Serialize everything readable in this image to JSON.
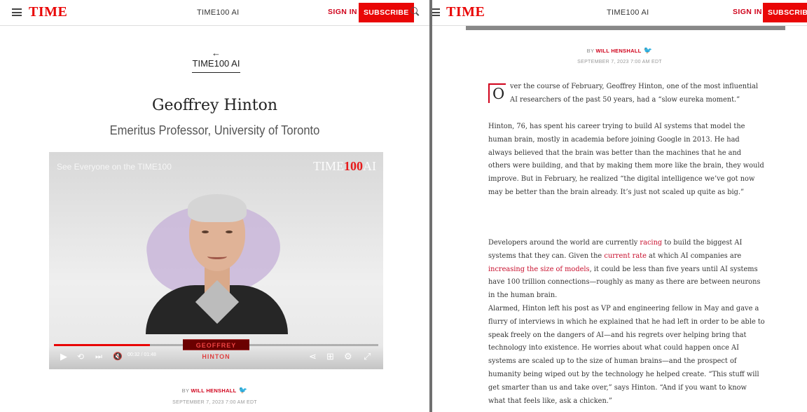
{
  "brand": {
    "logo": "TIME",
    "accent": "#e90606"
  },
  "left": {
    "header": {
      "section": "TIME100 AI",
      "sign_in": "SIGN IN",
      "subscribe": "SUBSCRIBE"
    },
    "back_link": "← TIME100 AI",
    "person": {
      "name": "Geoffrey Hinton",
      "title": "Emeritus Professor, University of Toronto"
    },
    "video": {
      "overlay_title": "See Everyone on the TIME100",
      "brand_prefix": "TIME",
      "brand_num": "100",
      "brand_suffix": "AI",
      "name_label": "GEOFFREY HINTON",
      "current_time": "00:32",
      "duration": "01:48",
      "progress_fraction": 0.296
    },
    "byline": {
      "by": "BY",
      "author": "WILL HENSHALL",
      "date": "SEPTEMBER 7, 2023 7:00 AM EDT"
    }
  },
  "right": {
    "header": {
      "section": "TIME100 AI",
      "sign_in": "SIGN IN",
      "subscribe": "SUBSCRIBE"
    },
    "byline": {
      "by": "BY",
      "author": "WILL HENSHALL",
      "date": "SEPTEMBER 7, 2023 7:00 AM EDT"
    },
    "article": {
      "dropcap": "O",
      "p1": "ver the course of February, Geoffrey Hinton, one of the most influential AI researchers of the past 50 years, had a “slow eureka moment.”",
      "p2": "Hinton, 76, has spent his career trying to build AI systems that model the human brain, mostly in academia before joining Google in 2013. He had always believed that the brain was better than the machines that he and others were building, and that by making them more like the brain, they would improve. But in February, he realized “the digital intelligence we’ve got now may be better than the brain already. It’s just not scaled up quite as big.”",
      "p3_a": "Developers around the world are currently ",
      "p3_link1": "racing",
      "p3_b": " to build the biggest AI systems that they can. Given the ",
      "p3_link2": "current rate",
      "p3_c": " at which AI companies are ",
      "p3_link3": "increasing the size of models",
      "p3_d": ", it could be less than five years until AI systems have 100 trillion connections—roughly as many as there are between neurons in the human brain.",
      "p4": "Alarmed, Hinton left his post as VP and engineering fellow in May and gave a flurry of interviews in which he explained that he had left in order to be able to speak freely on the dangers of AI—and his regrets over helping bring that technology into existence. He worries about what could happen once AI systems are scaled up to the size of human brains—and the prospect of humanity being wiped out by the technology he helped create. “This stuff will get smarter than us and take over,” says Hinton. “And if you want to know what that feels like, ask a chicken.”"
    }
  }
}
